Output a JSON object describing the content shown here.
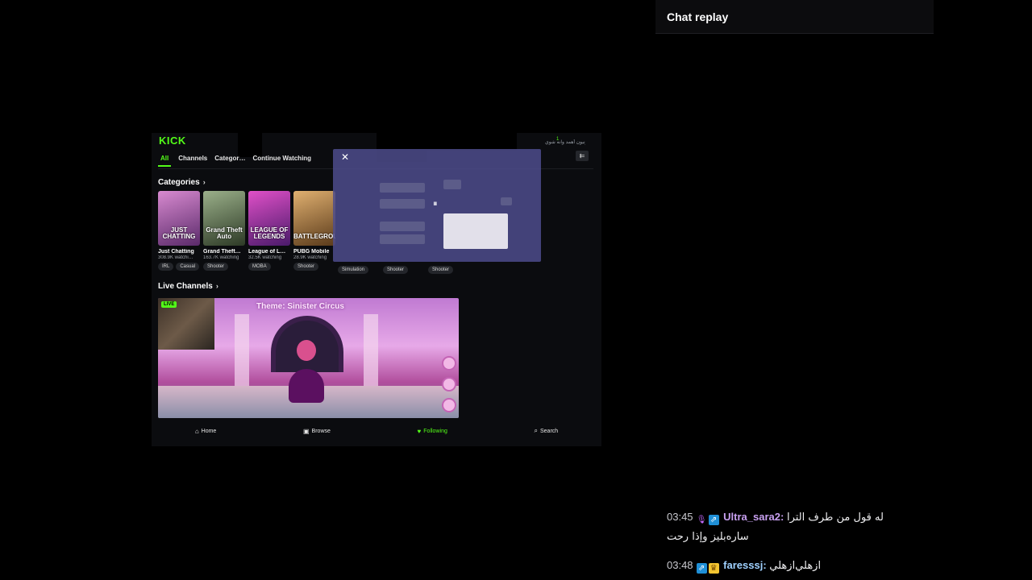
{
  "video": {
    "logo": "KICK",
    "notification_count": "1",
    "notification_text": "مونيون أهمد وانه شوي",
    "tabs": [
      {
        "label": "All",
        "active": true
      },
      {
        "label": "Channels",
        "active": false
      },
      {
        "label": "Categor…",
        "active": false
      },
      {
        "label": "Continue Watching",
        "active": false
      }
    ],
    "categories_title": "Categories",
    "categories": [
      {
        "thumb_text": "JUST CHATTING",
        "name": "Just Chatting",
        "viewers": "308.9K watchi…",
        "tags": [
          "IRL",
          "Casual"
        ],
        "color": "#7a3a8a"
      },
      {
        "thumb_text": "Grand Theft Auto",
        "name": "Grand Theft…",
        "viewers": "163.7K watching",
        "tags": [
          "Shooter"
        ],
        "color": "#4c6b3a"
      },
      {
        "thumb_text": "LEAGUE OF LEGENDS",
        "name": "League of L…",
        "viewers": "32.5K watching",
        "tags": [
          "MOBA"
        ],
        "color": "#b03aa0"
      },
      {
        "thumb_text": "BATTLEGROUNDS",
        "name": "PUBG Mobile",
        "viewers": "28.9K watching",
        "tags": [
          "Shooter"
        ],
        "color": "#7a5a30"
      }
    ],
    "extra_tags": [
      "Simulation",
      "Shooter",
      "Shooter"
    ],
    "live_channels_title": "Live Channels",
    "stream": {
      "live_label": "LIVE",
      "title": "Theme: Sinister Circus"
    },
    "bottom_nav": [
      {
        "label": "Home",
        "icon": "home-icon",
        "glyph": "⌂",
        "active": false
      },
      {
        "label": "Browse",
        "icon": "browse-icon",
        "glyph": "▣",
        "active": false
      },
      {
        "label": "Following",
        "icon": "heart-icon",
        "glyph": "♥",
        "active": true
      },
      {
        "label": "Search",
        "icon": "search-icon",
        "glyph": "⌕",
        "active": false
      }
    ],
    "overlay": {
      "close_glyph": "✕",
      "pause_glyph": "⏸"
    },
    "accent_color": "#53fc18"
  },
  "chat": {
    "title": "Chat replay",
    "messages": [
      {
        "time": "03:45",
        "badges": [
          "mic-icon",
          "subscriber-icon"
        ],
        "user": "Ultra_sara2",
        "user_color": "#c8a0f0",
        "text": "له قول من طرف الترا ساره‌بليز وإذا رحت"
      },
      {
        "time": "03:48",
        "badges": [
          "subscriber-icon",
          "crown-icon"
        ],
        "user": "faresssj",
        "user_color": "#9fd1ff",
        "text": "ازهلي‌ازهلي"
      }
    ]
  }
}
